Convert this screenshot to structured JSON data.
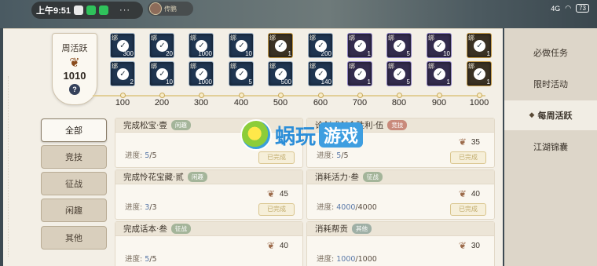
{
  "status_bar": {
    "time": "上午9:51",
    "dots": "···",
    "signal": "4G",
    "battery": "73"
  },
  "chat": {
    "name": "传鹏"
  },
  "badge": {
    "title": "周活跃",
    "value": "1010",
    "help": "?"
  },
  "milestones": [
    {
      "label": "100",
      "rewards": [
        {
          "qty": "300",
          "style": "blue"
        },
        {
          "qty": "2",
          "style": "blue"
        }
      ]
    },
    {
      "label": "200",
      "rewards": [
        {
          "qty": "20",
          "style": "blue"
        },
        {
          "qty": "10",
          "style": "blue"
        }
      ]
    },
    {
      "label": "300",
      "rewards": [
        {
          "qty": "1000",
          "style": "blue"
        },
        {
          "qty": "1000",
          "style": "blue"
        }
      ]
    },
    {
      "label": "400",
      "rewards": [
        {
          "qty": "10",
          "style": "blue"
        },
        {
          "qty": "5",
          "style": "blue"
        }
      ]
    },
    {
      "label": "500",
      "rewards": [
        {
          "qty": "1",
          "style": "gold"
        },
        {
          "qty": "500",
          "style": "blue"
        }
      ]
    },
    {
      "label": "600",
      "rewards": [
        {
          "qty": "200",
          "style": "blue"
        },
        {
          "qty": "140",
          "style": "blue"
        }
      ]
    },
    {
      "label": "700",
      "rewards": [
        {
          "qty": "1",
          "style": "purple"
        },
        {
          "qty": "1",
          "style": "purple"
        }
      ]
    },
    {
      "label": "800",
      "rewards": [
        {
          "qty": "5",
          "style": "purple"
        },
        {
          "qty": "5",
          "style": "purple"
        }
      ]
    },
    {
      "label": "900",
      "rewards": [
        {
          "qty": "10",
          "style": "purple"
        },
        {
          "qty": "1",
          "style": "purple"
        }
      ]
    },
    {
      "label": "1000",
      "rewards": [
        {
          "qty": "1",
          "style": "gold"
        },
        {
          "qty": "1",
          "style": "gold"
        }
      ]
    }
  ],
  "reward_bind_label": "绑",
  "categories": [
    {
      "label": "全部",
      "active": true
    },
    {
      "label": "竞技",
      "active": false
    },
    {
      "label": "征战",
      "active": false
    },
    {
      "label": "闲趣",
      "active": false
    },
    {
      "label": "其他",
      "active": false
    }
  ],
  "tasks": [
    {
      "title": "完成松宝·壹",
      "tag": "闲趣",
      "tag_color": "green",
      "progress_label": "进度:",
      "current": "5",
      "total": "/5",
      "reward": "",
      "done_label": "已完成"
    },
    {
      "title": "论剑或剑会胜利·伍",
      "tag": "竞技",
      "tag_color": "red",
      "progress_label": "进度:",
      "current": "5",
      "total": "/5",
      "reward": "35",
      "done_label": "已完成"
    },
    {
      "title": "完成怜花宝藏·贰",
      "tag": "闲趣",
      "tag_color": "green",
      "progress_label": "进度:",
      "current": "3",
      "total": "/3",
      "reward": "45",
      "done_label": "已完成"
    },
    {
      "title": "消耗活力·叁",
      "tag": "征战",
      "tag_color": "green",
      "progress_label": "进度:",
      "current": "4000",
      "total": "/4000",
      "reward": "40",
      "done_label": "已完成"
    },
    {
      "title": "完成话本·叁",
      "tag": "征战",
      "tag_color": "green",
      "progress_label": "进度:",
      "current": "5",
      "total": "/5",
      "reward": "40",
      "done_label": ""
    },
    {
      "title": "消耗帮贡",
      "tag": "其他",
      "tag_color": "gray",
      "progress_label": "进度:",
      "current": "1000",
      "total": "/1000",
      "reward": "30",
      "done_label": ""
    }
  ],
  "right_nav": [
    {
      "label": "必做任务",
      "active": false
    },
    {
      "label": "限时活动",
      "active": false
    },
    {
      "label": "每周活跃",
      "active": true
    },
    {
      "label": "江湖锦囊",
      "active": false
    }
  ],
  "watermark": {
    "text1": "蜗玩",
    "text2": "游戏"
  }
}
